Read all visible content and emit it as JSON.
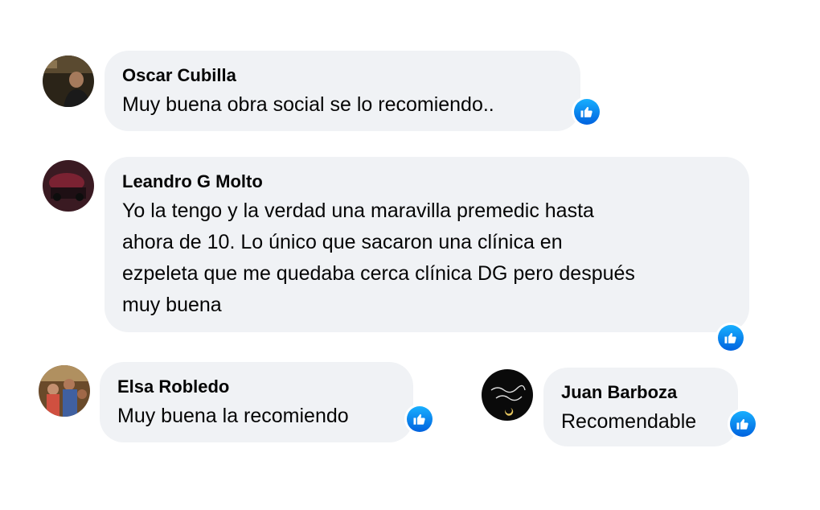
{
  "comments": [
    {
      "author": "Oscar Cubilla",
      "text": "Muy buena obra social se lo recomiendo..",
      "reaction": "like-icon"
    },
    {
      "author": "Leandro G Molto",
      "text": "Yo la tengo y la verdad una maravilla premedic hasta\nahora de 10. Lo único que sacaron una clínica en\nezpeleta que me quedaba cerca clínica DG pero después\nmuy buena",
      "reaction": "like-icon"
    },
    {
      "author": "Elsa Robledo",
      "text": "Muy buena la recomiendo",
      "reaction": "like-icon"
    },
    {
      "author": "Juan Barboza",
      "text": "Recomendable",
      "reaction": "like-icon"
    }
  ],
  "colors": {
    "bubble": "#f0f2f5",
    "like_top": "#18afff",
    "like_bottom": "#0062df"
  }
}
